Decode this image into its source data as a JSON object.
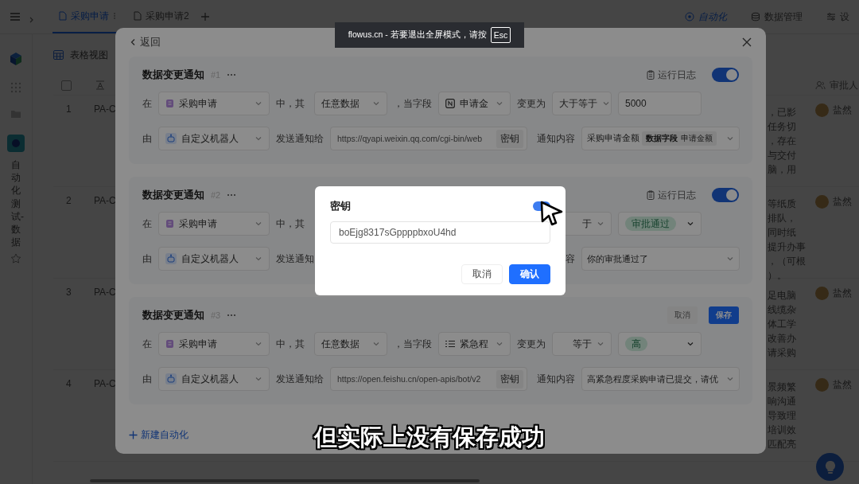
{
  "tabs_bar": {
    "tabs": [
      {
        "label": "采购申请",
        "selected": true,
        "has_more": true
      },
      {
        "label": "采购申请2",
        "selected": false,
        "has_more": false
      }
    ],
    "actions": [
      {
        "kind": "automation",
        "label": "自动化",
        "selected": true
      },
      {
        "kind": "database",
        "label": "数据管理",
        "selected": false
      },
      {
        "kind": "settings",
        "label": "设",
        "selected": false
      }
    ]
  },
  "sidebar": {
    "workspace": {
      "label": "自动化测试-数据",
      "selected": true
    }
  },
  "view": {
    "label": "表格视图"
  },
  "table": {
    "all_checked": false,
    "approver_header": "审批人",
    "rows": [
      {
        "index": "1",
        "title": "PA-C",
        "notes": [
          "，已影",
          "任务切",
          "，存在",
          "与交付",
          "脑，用"
        ],
        "approver": "盐然"
      },
      {
        "index": "2",
        "title": "PA-C",
        "notes": [
          "等纸质",
          "排队，",
          "同时纸",
          "提升办事",
          "，（可根",
          "）。"
        ],
        "approver": "盐然"
      },
      {
        "index": "3",
        "title": "PA-C",
        "notes": [
          "足电脑",
          "线缆杂",
          "体工学",
          "改善办",
          "请采购"
        ],
        "approver": "盐然"
      },
      {
        "index": "4",
        "title": "PA-C",
        "notes": [
          "景频繁",
          "响沟通",
          "导致理",
          "培训效",
          "匹配亮"
        ],
        "approver": "盐然"
      }
    ]
  },
  "panel": {
    "back": "返回",
    "new_label": "新建自动化",
    "rules": [
      {
        "title": "数据变更通知",
        "number": "#1",
        "actions": {
          "kind": "toggle",
          "log": "运行日志",
          "on": true
        },
        "condition": {
          "in": "在",
          "table": "采购申请",
          "of": "中，其",
          "scope": "任意数据",
          "when": "，当字段",
          "field": {
            "kind": "number",
            "label": "申请金"
          },
          "change": "变更为",
          "operator": "大于等于",
          "value": {
            "kind": "input",
            "text": "5000"
          }
        },
        "send": {
          "by": "由",
          "sender": "自定义机器人",
          "to": "发送通知给",
          "url": "https://qyapi.weixin.qq.com/cgi-bin/web",
          "key": "密钥",
          "content_label": "通知内容",
          "content": {
            "text": "采购申请金额",
            "chip": {
              "label": "数据字段",
              "value": "申请金额"
            }
          }
        }
      },
      {
        "title": "数据变更通知",
        "number": "#2",
        "actions": {
          "kind": "toggle",
          "log": "运行日志",
          "on": true
        },
        "condition": {
          "in": "在",
          "table": "采购申请",
          "of": "中，其",
          "operator": "于",
          "value": {
            "kind": "tag",
            "text": "审批通过"
          }
        },
        "send": {
          "by": "由",
          "sender": "自定义机器人",
          "to": "发送通知",
          "content_label": "容",
          "content": {
            "text": "你的审批通过了"
          }
        }
      },
      {
        "title": "数据变更通知",
        "number": "#3",
        "actions": {
          "kind": "edit",
          "cancel": "取消",
          "save": "保存"
        },
        "condition": {
          "in": "在",
          "table": "采购申请",
          "of": "中，其",
          "scope": "任意数据",
          "when": "，当字段",
          "field": {
            "kind": "list",
            "label": "紧急程"
          },
          "change": "变更为",
          "operator": "等于",
          "value": {
            "kind": "tag",
            "text": "高"
          }
        },
        "send": {
          "by": "由",
          "sender": "自定义机器人",
          "to": "发送通知给",
          "url": "https://open.feishu.cn/open-apis/bot/v2",
          "key": "密钥",
          "content_label": "通知内容",
          "content": {
            "text": "高紧急程度采购申请已提交，请优"
          }
        }
      }
    ]
  },
  "key_dialog": {
    "title": "密钥",
    "toggle_on": true,
    "value": "boEjg8317sGppppbxoU4hd",
    "cancel": "取消",
    "confirm": "确认"
  },
  "toast": {
    "text": "flowus.cn - 若要退出全屏模式，请按",
    "key": "Esc"
  },
  "subtitle": "但实际上没有保存成功"
}
